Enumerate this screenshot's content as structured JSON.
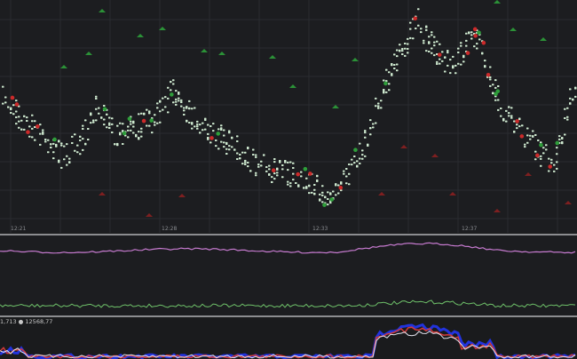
{
  "time_axis": {
    "labels": [
      "12:21",
      "12:28",
      "12:33",
      "12:37"
    ]
  },
  "legend": {
    "text": "1,713 ● 12568,77"
  },
  "colors": {
    "background": "#1c1d20",
    "grid": "#2a2c30",
    "price_dots": "#cfead0",
    "buy_marker": "#2e9e3a",
    "sell_marker": "#cc2a2a",
    "indicator_1": "#c77bd0",
    "indicator_2": "#6fc26a",
    "bottom_blue": "#2233dd",
    "bottom_red": "#d23a3a",
    "bottom_white": "#e6e6f0",
    "divider": "#8c8d90"
  }
}
